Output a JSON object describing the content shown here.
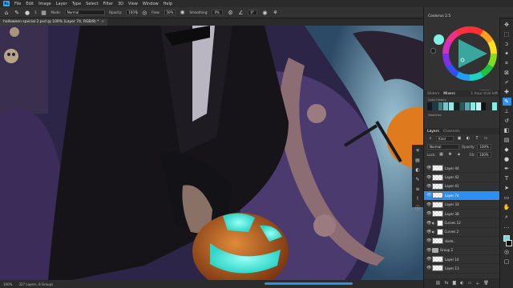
{
  "menubar": {
    "logo": "Ps",
    "items": [
      "File",
      "Edit",
      "Image",
      "Layer",
      "Type",
      "Select",
      "Filter",
      "3D",
      "View",
      "Window",
      "Help"
    ]
  },
  "options": {
    "mode_label": "Mode:",
    "mode_value": "Normal",
    "opacity_label": "Opacity:",
    "opacity_value": "100%",
    "flow_label": "Flow:",
    "flow_value": "50%",
    "smoothing_label": "Smoothing:",
    "smoothing_value": "0%",
    "angle_value": "0°",
    "brush_size": "3"
  },
  "document": {
    "tab_title": "halloween special 2.psd @ 100% (Layer 74, RGB/8) *"
  },
  "status": {
    "zoom": "100%",
    "info": "327 Layers, 8 Groups"
  },
  "color_panel": {
    "title": "Coolorus 2.5",
    "hex": "#7FF0E4"
  },
  "slider_panel": {
    "tabs": [
      "Sliders",
      "Mixers"
    ],
    "mix_label": "1 hour trial left",
    "sub1": "Color History",
    "sub2": "Swatches",
    "history": [
      "#0e1c22",
      "#1d3b43",
      "#3f7c84",
      "#6fc7cc",
      "#9ae6e6",
      "#0f2126",
      "#2a5960",
      "#58a7ad",
      "#7ff0e4",
      "#c4f5f2",
      "#111",
      "#2c2c2c",
      "#7ff0e4"
    ]
  },
  "layers_panel": {
    "tabs": [
      "Layers",
      "Channels"
    ],
    "kind_label": "Kind",
    "blend_mode": "Normal",
    "opacity_label": "Opacity:",
    "opacity_value": "100%",
    "lock_label": "Lock:",
    "fill_label": "Fill:",
    "fill_value": "100%",
    "layers": [
      {
        "name": "Layer 44",
        "type": "layer"
      },
      {
        "name": "Layer 42",
        "type": "layer"
      },
      {
        "name": "Layer 41",
        "type": "layer"
      },
      {
        "name": "Layer 74",
        "type": "layer",
        "selected": true
      },
      {
        "name": "Layer 33",
        "type": "layer"
      },
      {
        "name": "Layer 38",
        "type": "layer"
      },
      {
        "name": "Curves 12",
        "type": "adjust"
      },
      {
        "name": "Curves 2",
        "type": "adjust"
      },
      {
        "name": "skele..",
        "type": "layer"
      },
      {
        "name": "Group 2",
        "type": "group"
      },
      {
        "name": "Layer 14",
        "type": "layer"
      },
      {
        "name": "Layer 13",
        "type": "layer"
      }
    ]
  },
  "colors": {
    "accent": "#2f8ff0",
    "foreground": "#7ff0e4",
    "pumpkin_glow": "#5ff0e0",
    "pumpkin": "#c96a24"
  }
}
